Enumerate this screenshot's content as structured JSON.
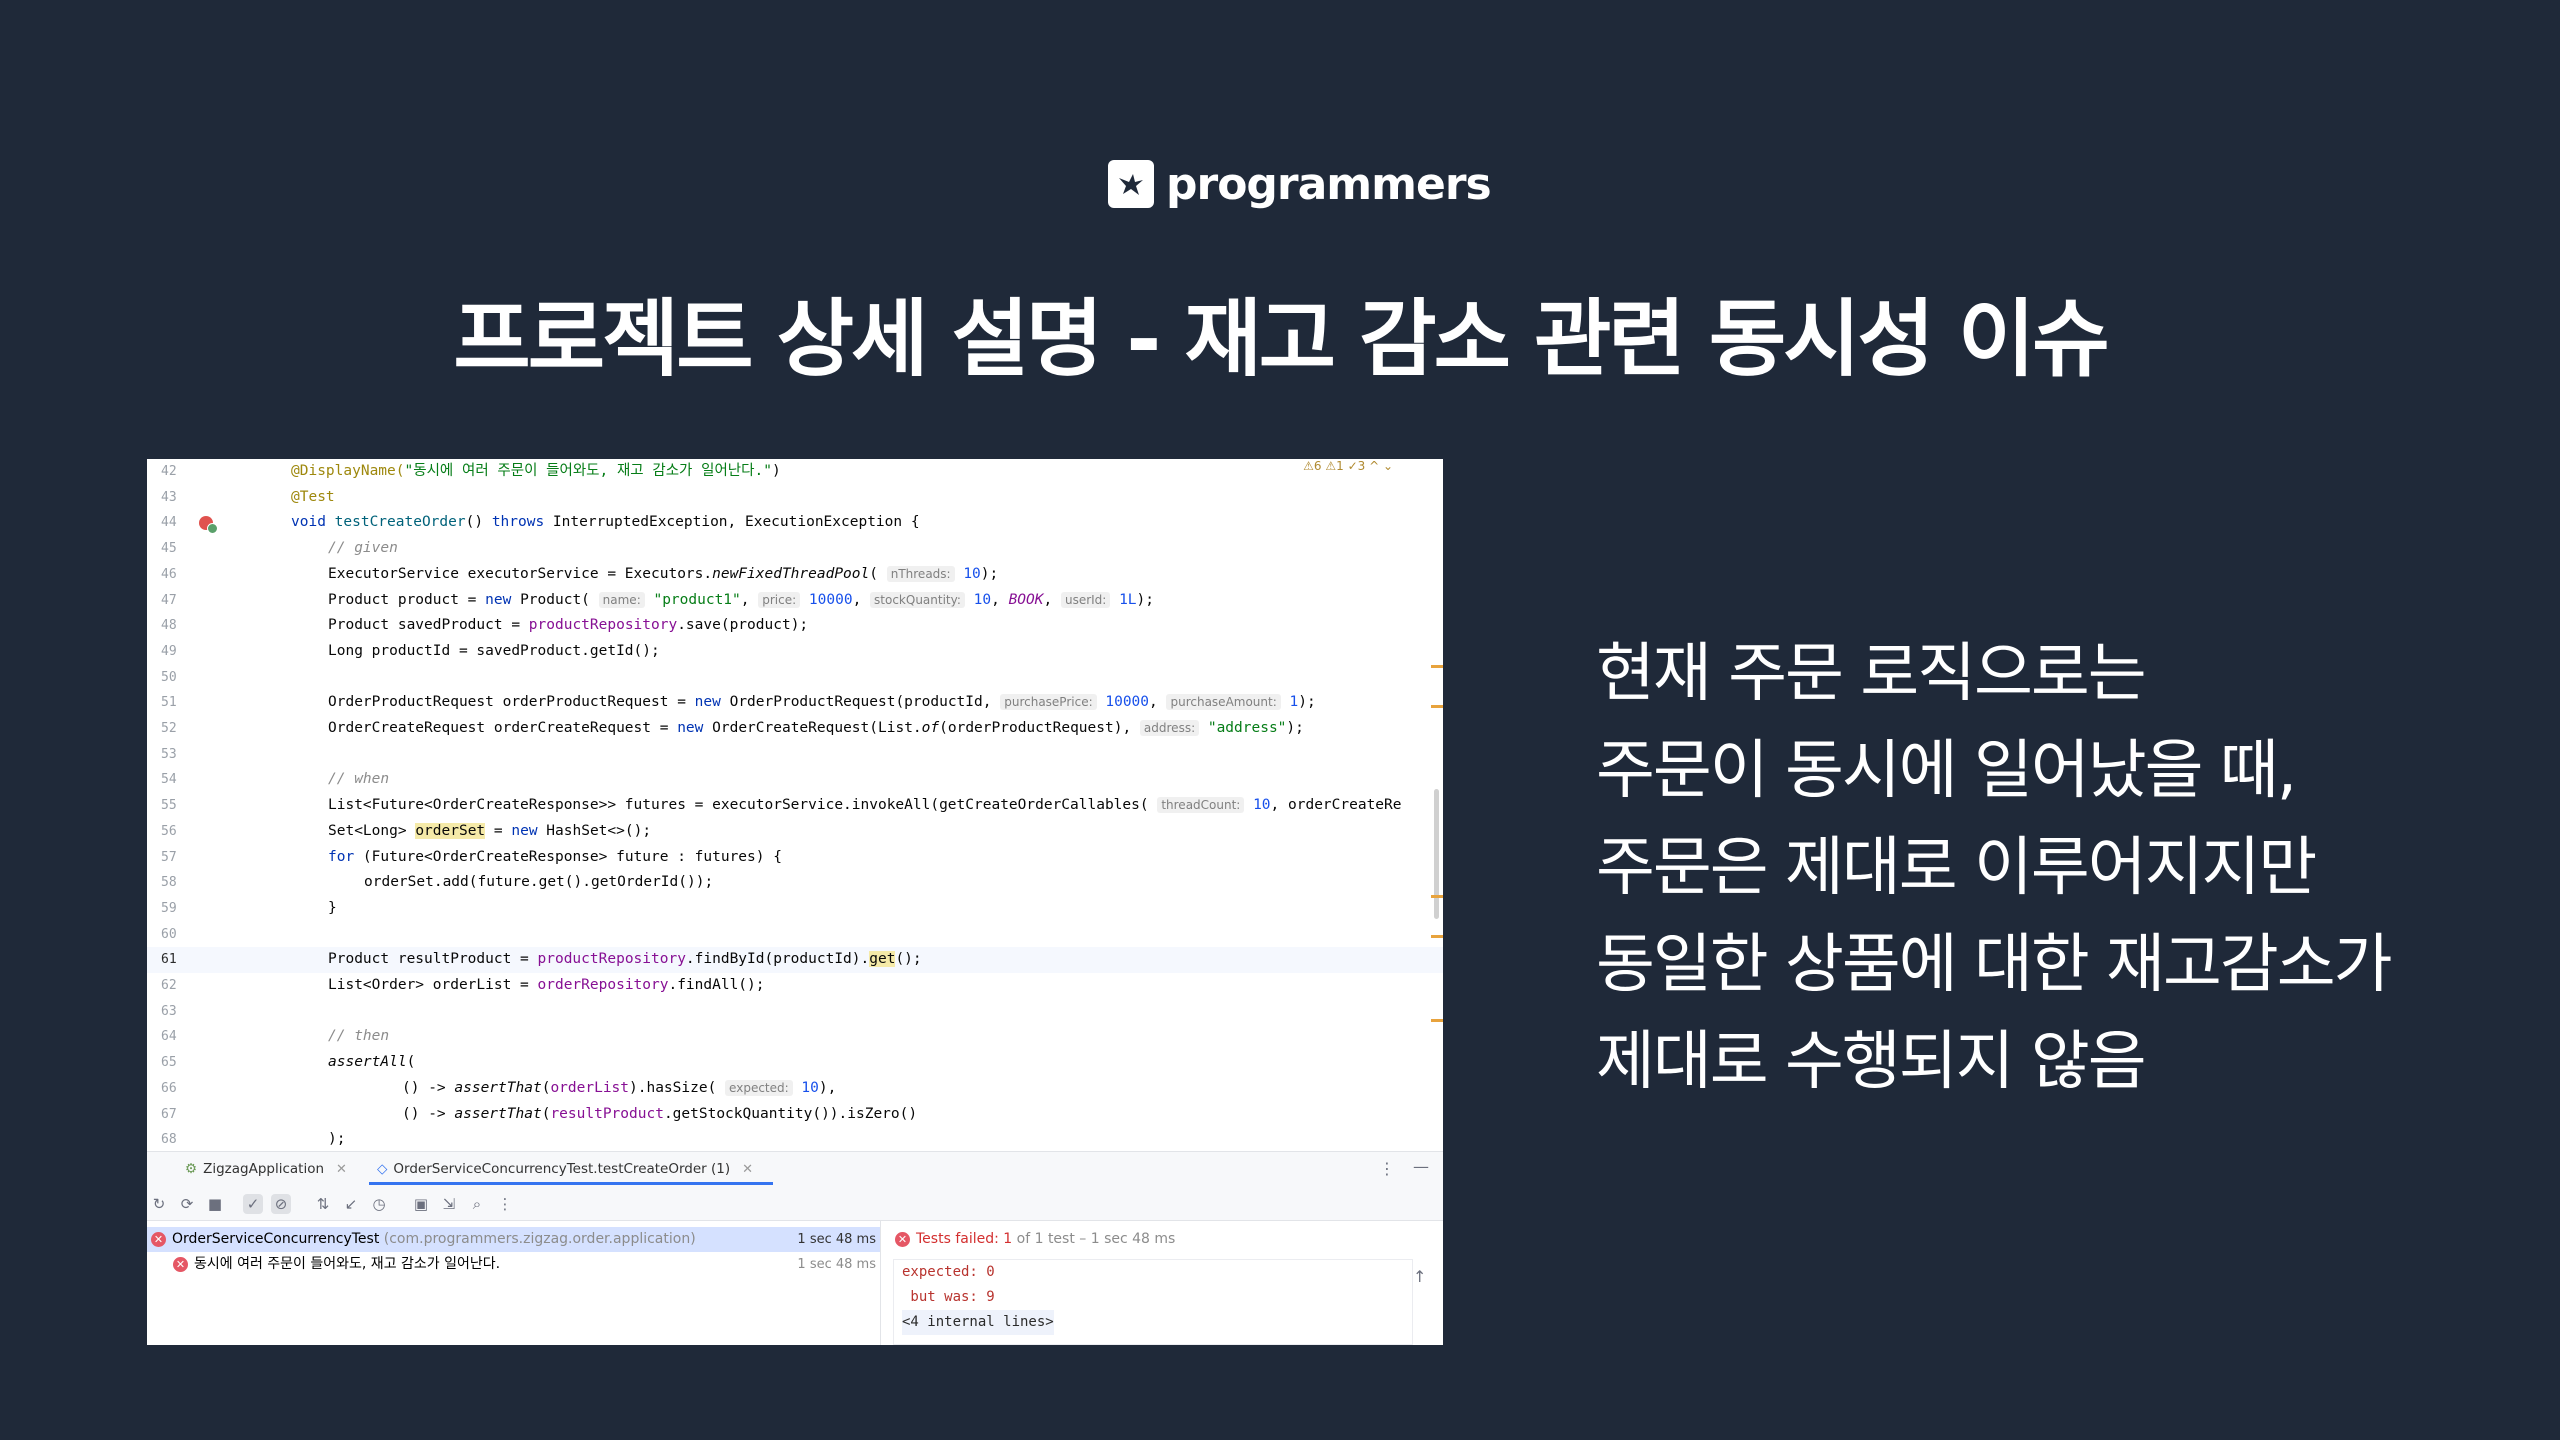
{
  "brand": {
    "name": "programmers"
  },
  "title": "프로젝트 상세 설명 - 재고 감소 관련 동시성 이슈",
  "editor": {
    "warnings": "⚠6 ⚠1 ✓3 ^ ⌄",
    "lines": [
      {
        "n": "42"
      },
      {
        "n": "43"
      },
      {
        "n": "44"
      },
      {
        "n": "45"
      },
      {
        "n": "46"
      },
      {
        "n": "47"
      },
      {
        "n": "48"
      },
      {
        "n": "49"
      },
      {
        "n": "50"
      },
      {
        "n": "51"
      },
      {
        "n": "52"
      },
      {
        "n": "53"
      },
      {
        "n": "54"
      },
      {
        "n": "55"
      },
      {
        "n": "56"
      },
      {
        "n": "57"
      },
      {
        "n": "58"
      },
      {
        "n": "59"
      },
      {
        "n": "60"
      },
      {
        "n": "61"
      },
      {
        "n": "62"
      },
      {
        "n": "63"
      },
      {
        "n": "64"
      },
      {
        "n": "65"
      },
      {
        "n": "66"
      },
      {
        "n": "67"
      },
      {
        "n": "68"
      }
    ],
    "code": {
      "l42_ann": "@DisplayName(",
      "l42_str": "\"동시에 여러 주문이 들어와도, 재고 감소가 일어난다.\"",
      "l42_end": ")",
      "l43": "@Test",
      "l44_kw": "void",
      "l44_fn": "testCreateOrder",
      "l44_a": "() ",
      "l44_throws": "throws",
      "l44_b": " InterruptedException, ExecutionException {",
      "l45": "// given",
      "l46_a": "ExecutorService executorService = Executors.",
      "l46_m": "newFixedThreadPool",
      "l46_b": "( ",
      "l46_hint": "nThreads:",
      "l46_num": "10",
      "l46_c": ");",
      "l47_a": "Product product = ",
      "l47_new": "new",
      "l47_b": " Product( ",
      "l47_h1": "name:",
      "l47_s": "\"product1\"",
      "l47_c": ", ",
      "l47_h2": "price:",
      "l47_n1": "10000",
      "l47_d": ", ",
      "l47_h3": "stockQuantity:",
      "l47_n2": "10",
      "l47_e": ", ",
      "l47_book": "BOOK",
      "l47_f": ", ",
      "l47_h4": "userId:",
      "l47_n3": "1L",
      "l47_g": ");",
      "l48_a": "Product savedProduct = ",
      "l48_f": "productRepository",
      "l48_b": ".save(product);",
      "l49": "Long productId = savedProduct.getId();",
      "l51_a": "OrderProductRequest orderProductRequest = ",
      "l51_new": "new",
      "l51_b": " OrderProductRequest(productId, ",
      "l51_h1": "purchasePrice:",
      "l51_n1": "10000",
      "l51_c": ", ",
      "l51_h2": "purchaseAmount:",
      "l51_n2": "1",
      "l51_d": ");",
      "l52_a": "OrderCreateRequest orderCreateRequest = ",
      "l52_new": "new",
      "l52_b": " OrderCreateRequest(List.",
      "l52_m": "of",
      "l52_c": "(orderProductRequest), ",
      "l52_h": "address:",
      "l52_s": "\"address\"",
      "l52_d": ");",
      "l54": "// when",
      "l55_a": "List<Future<OrderCreateResponse>> futures = executorService.invokeAll(getCreateOrderCallables( ",
      "l55_h": "threadCount:",
      "l55_n": "10",
      "l55_b": ", orderCreateRe",
      "l56_a": "Set<Long> ",
      "l56_v": "orderSet",
      "l56_b": " = ",
      "l56_new": "new",
      "l56_c": " HashSet<>();",
      "l57_for": "for",
      "l57_a": " (Future<OrderCreateResponse> future : futures) {",
      "l58": "orderSet.add(future.get().getOrderId());",
      "l59": "}",
      "l61_a": "Product resultProduct = ",
      "l61_f": "productRepository",
      "l61_b": ".findById(productId).",
      "l61_get": "get",
      "l61_c": "();",
      "l62_a": "List<Order> orderList = ",
      "l62_f": "orderRepository",
      "l62_b": ".findAll();",
      "l64": "// then",
      "l65_m": "assertAll",
      "l65_b": "(",
      "l66_a": "() -> ",
      "l66_m": "assertThat",
      "l66_b": "(",
      "l66_f": "orderList",
      "l66_c": ").hasSize( ",
      "l66_h": "expected:",
      "l66_n": "10",
      "l66_d": "),",
      "l67_a": "() -> ",
      "l67_m": "assertThat",
      "l67_b": "(",
      "l67_f": "resultProduct",
      "l67_c": ".getStockQuantity()).isZero()",
      "l68": ");"
    }
  },
  "run_panel": {
    "tabs": [
      {
        "label": "ZigzagApplication"
      },
      {
        "label": "OrderServiceConcurrencyTest.testCreateOrder (1)"
      }
    ],
    "tree": [
      {
        "name": "OrderServiceConcurrencyTest",
        "pkg": "(com.programmers.zigzag.order.application)",
        "duration": "1 sec 48 ms"
      },
      {
        "name": "동시에 여러 주문이 들어와도, 재고 감소가 일어난다.",
        "duration": "1 sec 48 ms"
      }
    ],
    "status": {
      "failed": "Tests failed: 1",
      "rest": " of 1 test – 1 sec 48 ms"
    },
    "output": [
      "expected: 0",
      " but was: 9",
      "<4 internal lines>"
    ]
  },
  "description": [
    "현재 주문 로직으로는",
    "주문이 동시에 일어났을 때,",
    "주문은 제대로 이루어지지만",
    "동일한 상품에 대한 재고감소가",
    "제대로 수행되지 않음"
  ],
  "colors": {
    "background": "#1f2939",
    "accent": "#3574f0",
    "fail": "#e55765"
  }
}
